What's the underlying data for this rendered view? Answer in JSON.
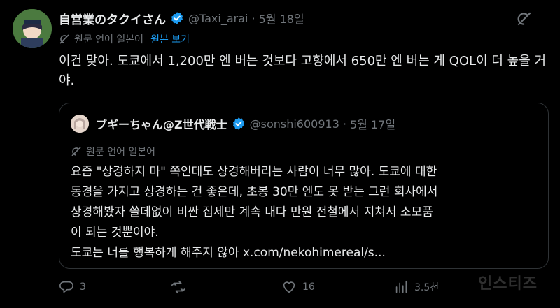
{
  "tweet": {
    "author_name": "自営業のタクイさん",
    "handle": "@Taxi_arai",
    "separator": "·",
    "date": "5월 18일",
    "translate_label": "원문 언어 일본어",
    "view_original": "원본 보기",
    "text": "이건 맞아. 도쿄에서 1,200만 엔 버는 것보다 고향에서 650만 엔 버는 게 QOL이 더 높을 거야."
  },
  "quote": {
    "author_name": "ブギーちゃん@Z世代戦士",
    "handle": "@sonshi600913",
    "separator": "·",
    "date": "5월 17일",
    "translate_label": "원문 언어 일본어",
    "text": "요즘 \"상경하지 마\" 쪽인데도 상경해버리는 사람이 너무 많아. 도쿄에 대한\n동경을 가지고 상경하는 건 좋은데, 초봉 30만 엔도 못 받는 그런 회사에서\n상경해봤자 쓸데없이 비싼 집세만 계속 내다 만원 전철에서 지쳐서 소모품\n이 되는 것뿐이야.\n도쿄는 너를 행복하게 해주지 않아 x.com/nekohimereal/s..."
  },
  "actions": {
    "reply_count": "3",
    "retweet_count": "",
    "like_count": "16",
    "view_count": "3.5천"
  },
  "watermark": "인스티즈",
  "colors": {
    "background": "#000000",
    "text": "#e7e9ea",
    "muted": "#71767b",
    "accent": "#1d9bf0",
    "border": "#2f3336"
  },
  "icons": [
    "verified-badge-icon",
    "grok-icon",
    "translate-icon",
    "reply-icon",
    "retweet-icon",
    "like-icon",
    "views-icon"
  ]
}
